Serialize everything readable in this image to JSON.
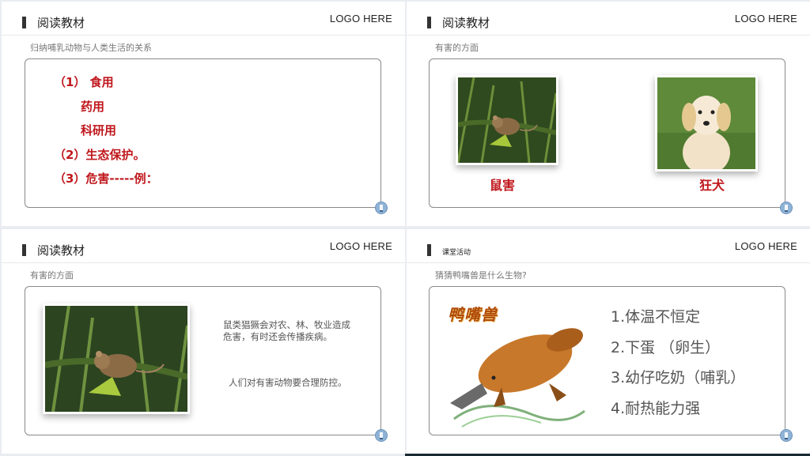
{
  "logo_text": "LOGO HERE",
  "slide1": {
    "title": "阅读教材",
    "subtitle": "归纳哺乳动物与人类生活的关系",
    "items": [
      "（1） 食用",
      "药用",
      "科研用",
      "（2）生态保护。",
      "（3）危害-----例："
    ]
  },
  "slide2": {
    "title": "阅读教材",
    "subtitle": "有害的方面",
    "caption_left": "鼠害",
    "caption_right": "狂犬"
  },
  "slide3": {
    "title": "阅读教材",
    "subtitle": "有害的方面",
    "para1": "鼠类猖獗会对农、林、牧业造成危害，有时还会传播疾病。",
    "para2": "人们对有害动物要合理防控。"
  },
  "slide4": {
    "title": "课堂活动",
    "subtitle": "猜猜鸭嘴兽是什么生物?",
    "image_title": "鸭嘴兽",
    "facts": [
      "1.体温不恒定",
      "2.下蛋 （卵生）",
      "3.幼仔吃奶（哺乳）",
      "4.耐热能力强"
    ]
  }
}
